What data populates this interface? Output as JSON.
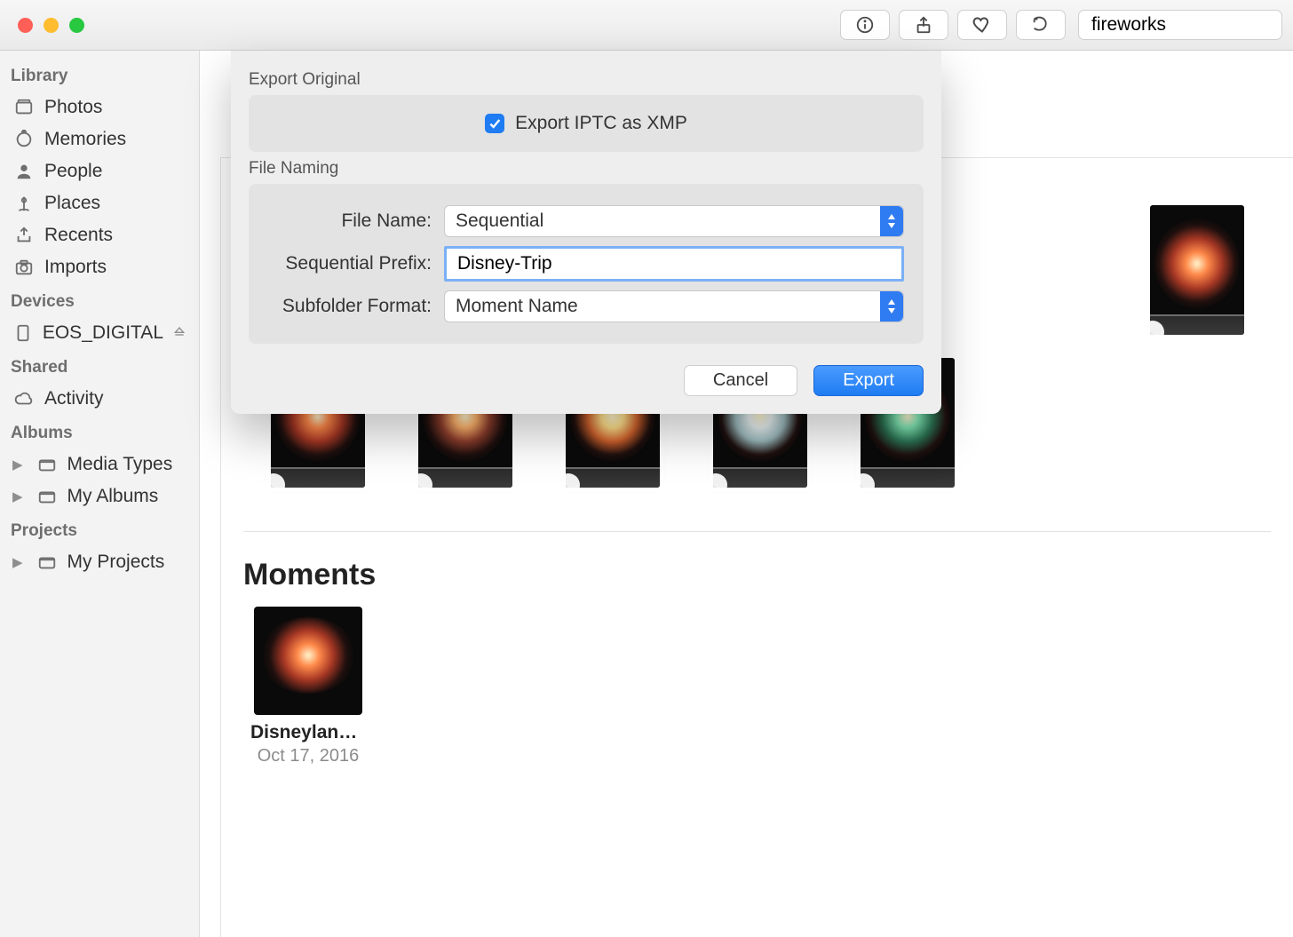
{
  "search": {
    "value": "fireworks"
  },
  "sidebar": {
    "sections": {
      "library": {
        "title": "Library",
        "items": [
          "Photos",
          "Memories",
          "People",
          "Places",
          "Recents",
          "Imports"
        ]
      },
      "devices": {
        "title": "Devices",
        "items": [
          "EOS_DIGITAL"
        ]
      },
      "shared": {
        "title": "Shared",
        "items": [
          "Activity"
        ]
      },
      "albums": {
        "title": "Albums",
        "items": [
          "Media Types",
          "My Albums"
        ]
      },
      "projects": {
        "title": "Projects",
        "items": [
          "My Projects"
        ]
      }
    }
  },
  "toolbar_icons": [
    "info-icon",
    "share-icon",
    "heart-icon",
    "rotate-icon"
  ],
  "dialog": {
    "section_export_original": "Export Original",
    "export_iptc_label": "Export IPTC as XMP",
    "export_iptc_checked": true,
    "section_file_naming": "File Naming",
    "file_name_label": "File Name:",
    "file_name_value": "Sequential",
    "prefix_label": "Sequential Prefix:",
    "prefix_value": "Disney-Trip",
    "subfolder_label": "Subfolder Format:",
    "subfolder_value": "Moment Name",
    "cancel": "Cancel",
    "export": "Export"
  },
  "content": {
    "moments_heading": "Moments",
    "moment": {
      "title": "Disneyland…",
      "date": "Oct 17, 2016"
    }
  },
  "thumb_colors": [
    {
      "c1": "#ff8a4a",
      "c2": "#a83825"
    },
    {
      "c1": "#ffb36b",
      "c2": "#8c3d2c"
    },
    {
      "c1": "#ffe18a",
      "c2": "#d0622d"
    },
    {
      "c1": "#e8f1f2",
      "c2": "#9ab8bb"
    },
    {
      "c1": "#7fe4b2",
      "c2": "#2c7555"
    }
  ]
}
